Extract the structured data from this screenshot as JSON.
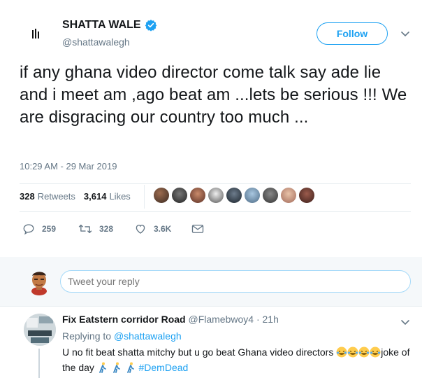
{
  "tweet": {
    "author_name": "SHATTA WALE",
    "author_handle": "@shattawalegh",
    "follow_label": "Follow",
    "text": "if any ghana video director come talk say ade lie and i meet am ,ago beat am ...lets be serious !!! We are disgracing our country too much ...",
    "timestamp": "10:29 AM - 29 Mar 2019",
    "retweets_count": "328",
    "retweets_label": "Retweets",
    "likes_count": "3,614",
    "likes_label": "Likes"
  },
  "actions": {
    "reply_count": "259",
    "retweet_count": "328",
    "like_count": "3.6K"
  },
  "reply_box": {
    "placeholder": "Tweet your reply"
  },
  "reply": {
    "author_name": "Fix Eatstern corridor Road",
    "author_handle": "@Flamebwoy4",
    "age": "· 21h",
    "replying_to_label": "Replying to",
    "replying_to_handle": "@shattawalegh",
    "text_part1": "U no fit beat shatta mitchy but u go beat Ghana video directors",
    "text_part2": "joke of the day",
    "hashtag": "#DemDead"
  },
  "colors": {
    "accent": "#1da1f2",
    "secondary_text": "#657786",
    "divider": "#e6ecf0"
  }
}
